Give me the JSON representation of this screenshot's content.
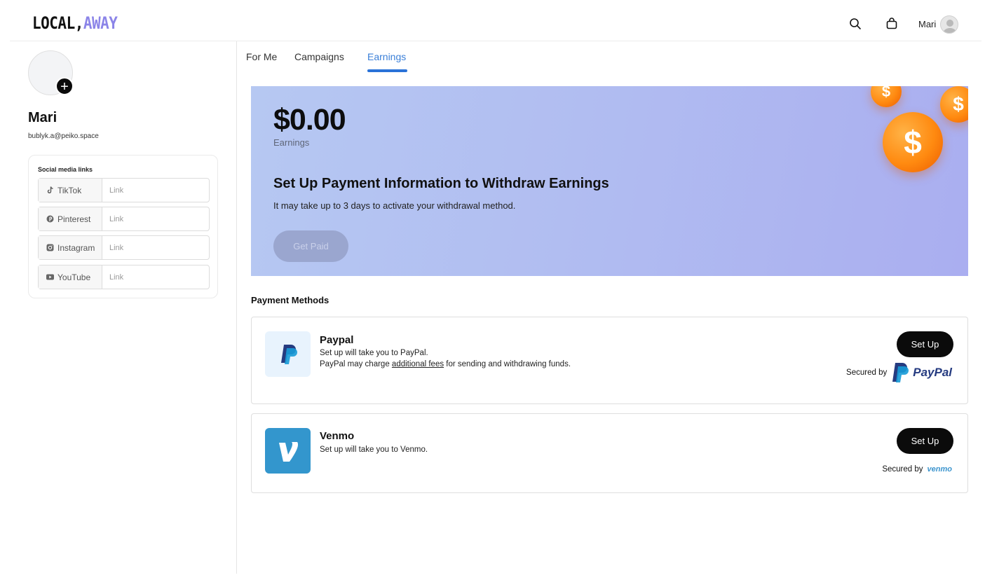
{
  "header": {
    "logo_part1": "LOCAL,",
    "logo_part2": "AWAY",
    "user_name": "Mari",
    "icons": [
      "search-icon",
      "bag-icon",
      "avatar"
    ]
  },
  "profile": {
    "name": "Mari",
    "email": "bublyk.a@peiko.space",
    "add_photo_symbol": "+"
  },
  "social": {
    "title": "Social media links",
    "items": [
      {
        "label": "TikTok",
        "placeholder": "Link",
        "icon": "tiktok-icon"
      },
      {
        "label": "Pinterest",
        "placeholder": "Link",
        "icon": "pinterest-icon"
      },
      {
        "label": "Instagram",
        "placeholder": "Link",
        "icon": "instagram-icon"
      },
      {
        "label": "YouTube",
        "placeholder": "Link",
        "icon": "youtube-icon"
      }
    ]
  },
  "tabs": [
    {
      "label": "For Me",
      "active": false
    },
    {
      "label": "Campaigns",
      "active": false
    },
    {
      "label": "Earnings",
      "active": true
    }
  ],
  "banner": {
    "amount": "$0.00",
    "amount_label": "Earnings",
    "title": "Set Up Payment Information to Withdraw Earnings",
    "subtitle": "It may take up to 3 days to activate your withdrawal method.",
    "button": "Get Paid",
    "coin_symbol": "$"
  },
  "payment_methods": {
    "heading": "Payment Methods",
    "paypal": {
      "name": "Paypal",
      "line1": "Set up will take you to PayPal.",
      "line2_before": "PayPal may charge ",
      "line2_link": "additional fees",
      "line2_after": " for sending and withdrawing funds.",
      "button": "Set Up",
      "secured_by": "Secured by",
      "wordmark": "PayPal",
      "logo_letter": "P"
    },
    "venmo": {
      "name": "Venmo",
      "line1": "Set up will take you to Venmo.",
      "button": "Set Up",
      "secured_by": "Secured by",
      "wordmark": "venmo",
      "logo_letter": "V"
    }
  },
  "colors": {
    "accent": "#2a72d8",
    "logo_accent": "#8b84e8",
    "banner": "#b1bdf1",
    "button": "#0b0b0b",
    "coin": "#ff8a10",
    "paypal_blue": "#253b80",
    "venmo_blue": "#3d95ce"
  }
}
